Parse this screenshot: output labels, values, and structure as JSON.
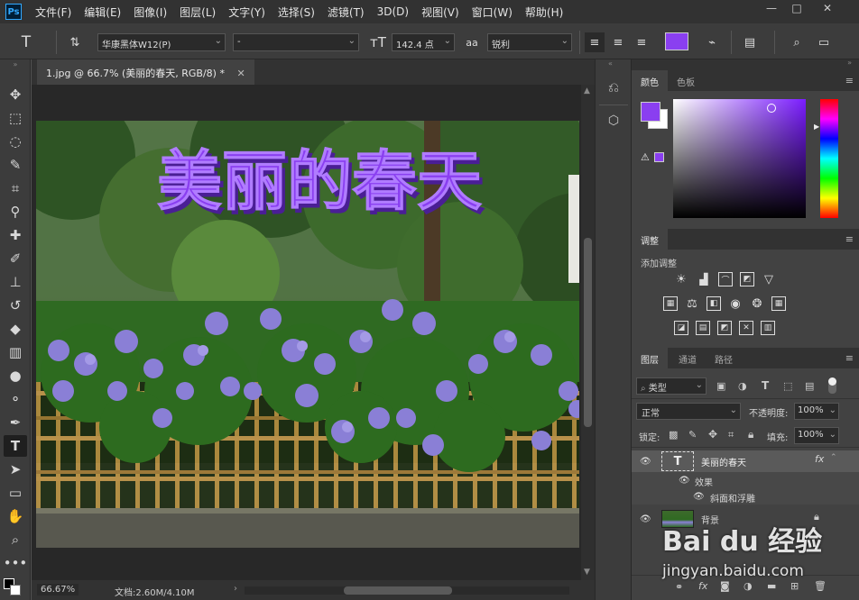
{
  "app": {
    "logo": "Ps"
  },
  "menu": [
    "文件(F)",
    "编辑(E)",
    "图像(I)",
    "图层(L)",
    "文字(Y)",
    "选择(S)",
    "滤镜(T)",
    "3D(D)",
    "视图(V)",
    "窗口(W)",
    "帮助(H)"
  ],
  "window_controls": {
    "min": "—",
    "max": "□",
    "close": "✕"
  },
  "options": {
    "font_family": "华康黑体W12(P)",
    "font_style": "-",
    "font_size": "142.4 点",
    "aa_icon_label": "aa",
    "antialias": "锐利",
    "text_color": "#8a3ff0"
  },
  "document": {
    "tab_title": "1.jpg @ 66.7% (美丽的春天, RGB/8) *",
    "tab_close": "✕",
    "canvas_text": "美丽的春天",
    "zoom": "66.67%",
    "doc_size": "文档:2.60M/4.10M"
  },
  "color_panel": {
    "tabs": [
      "颜色",
      "色板"
    ],
    "foreground": "#8a3ff0",
    "background": "#ffffff",
    "hue": "#7a1cff"
  },
  "adjust_panel": {
    "title": "调整",
    "subtitle": "添加调整"
  },
  "layers_panel": {
    "tabs": [
      "图层",
      "通道",
      "路径"
    ],
    "filter_kind": "类型",
    "blend_mode": "正常",
    "opacity_label": "不透明度:",
    "opacity_value": "100%",
    "lock_label": "锁定:",
    "fill_label": "填充:",
    "fill_value": "100%",
    "layers": [
      {
        "name": "美丽的春天",
        "type": "T",
        "fx": "fx"
      },
      {
        "name": "效果"
      },
      {
        "name": "斜面和浮雕"
      },
      {
        "name": "背景"
      }
    ]
  },
  "watermark": {
    "brand": "Bai du 经验",
    "url": "jingyan.baidu.com"
  }
}
